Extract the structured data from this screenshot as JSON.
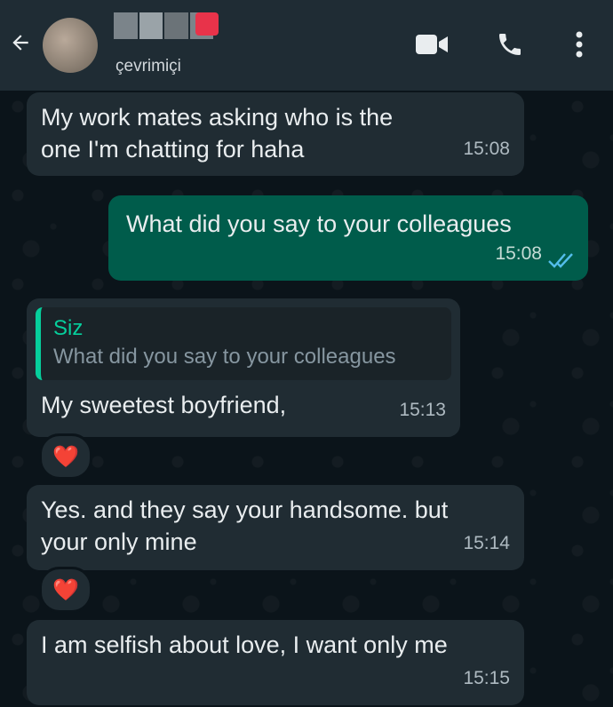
{
  "header": {
    "status": "çevrimiçi",
    "icons": [
      "back-arrow-icon",
      "video-call-icon",
      "voice-call-icon",
      "more-options-icon"
    ]
  },
  "messages": [
    {
      "direction": "incoming",
      "text": "My work mates asking who is the one I'm chatting for haha",
      "time": "15:08"
    },
    {
      "direction": "outgoing",
      "text": "What did you say to your colleagues",
      "time": "15:08",
      "status": "read"
    },
    {
      "direction": "incoming",
      "quote_author": "Siz",
      "quote_text": "What did you say to your colleagues",
      "text": "My sweetest boyfriend,",
      "time": "15:13",
      "reaction": "❤️"
    },
    {
      "direction": "incoming",
      "text": "Yes. and they say your handsome. but your only mine",
      "time": "15:14",
      "reaction": "❤️"
    },
    {
      "direction": "incoming",
      "text": "I am selfish about love, I want only me",
      "time": "15:15"
    }
  ],
  "colors": {
    "header_bg": "#1f2c34",
    "chat_bg": "#0b141a",
    "incoming_bubble": "#202c33",
    "outgoing_bubble": "#005c4b",
    "accent": "#06cf9c",
    "read_ticks": "#53bdeb"
  }
}
